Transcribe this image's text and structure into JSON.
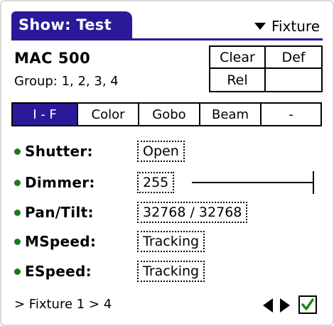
{
  "header": {
    "title": "Show: Test",
    "menu_label": "Fixture"
  },
  "fixture": {
    "name": "MAC 500",
    "group": "Group: 1, 2, 3, 4"
  },
  "buttons": {
    "clear": "Clear",
    "def": "Def",
    "rel": "Rel",
    "empty": ""
  },
  "tabs": [
    {
      "label": "I - F",
      "active": true
    },
    {
      "label": "Color",
      "active": false
    },
    {
      "label": "Gobo",
      "active": false
    },
    {
      "label": "Beam",
      "active": false
    },
    {
      "label": "-",
      "active": false
    }
  ],
  "params": {
    "shutter": {
      "label": "Shutter:",
      "value": "Open"
    },
    "dimmer": {
      "label": "Dimmer:",
      "value": "255",
      "level": 1.0
    },
    "pantilt": {
      "label": "Pan/Tilt:",
      "value": "32768 / 32768"
    },
    "mspeed": {
      "label": "MSpeed:",
      "value": "Tracking"
    },
    "espeed": {
      "label": "ESpeed:",
      "value": "Tracking"
    }
  },
  "footer": {
    "path": "> Fixture 1 > 4"
  },
  "colors": {
    "accent": "#2a1a99",
    "bullet": "#1a7a1a",
    "check": "#1a8a1a"
  }
}
